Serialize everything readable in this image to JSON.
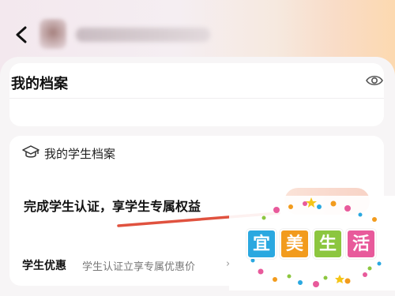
{
  "header": {
    "name_redacted": true
  },
  "profile_card": {
    "title": "我的档案",
    "visibility_icon": "eye-icon"
  },
  "student_card": {
    "icon": "graduation-cap-icon",
    "title": "我的学生档案",
    "promo_text": "完成学生认证，享学生专属权益",
    "benefit_label": "学生优惠",
    "benefit_desc": "学生认证立享专属优惠价",
    "benefit_chevron": "›"
  },
  "watermark": {
    "chars": [
      "宜",
      "美",
      "生",
      "活"
    ],
    "colors": [
      "#2aa8e0",
      "#f29b1d",
      "#8cc63f",
      "#e85a9b"
    ]
  },
  "annotation": {
    "arrow_color": "#e0523f"
  }
}
